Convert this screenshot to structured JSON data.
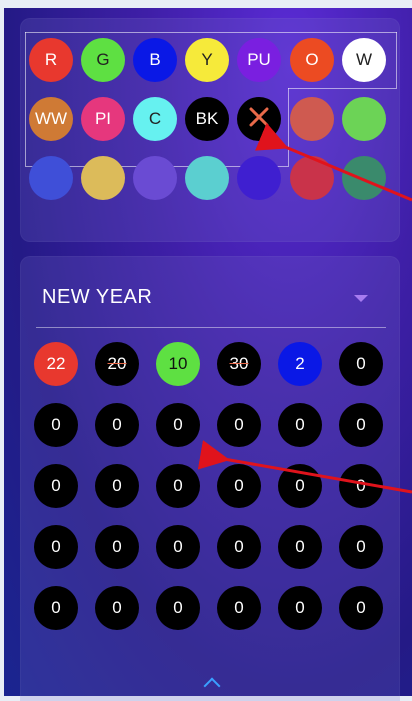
{
  "palette": {
    "row1": [
      {
        "label": "R",
        "color": "#e8382e"
      },
      {
        "label": "G",
        "color": "#5ee042"
      },
      {
        "label": "B",
        "color": "#0a18e6"
      },
      {
        "label": "Y",
        "color": "#f6ea3a"
      },
      {
        "label": "PU",
        "color": "#7a1fe0"
      },
      {
        "label": "O",
        "color": "#ec4b22"
      },
      {
        "label": "W",
        "color": "#ffffff"
      }
    ],
    "row2": [
      {
        "label": "WW",
        "color": "#cf7a35"
      },
      {
        "label": "PI",
        "color": "#e6377d"
      },
      {
        "label": "C",
        "color": "#66f1f0"
      },
      {
        "label": "BK",
        "color": "#000000"
      },
      {
        "label": "",
        "color": "#000000",
        "icon": "close-icon"
      },
      {
        "label": "",
        "color": "#cf5a50"
      },
      {
        "label": "",
        "color": "#6cd356"
      }
    ],
    "row3": [
      {
        "color": "#3f4fd8"
      },
      {
        "color": "#dcbb5a"
      },
      {
        "color": "#6a4bd3"
      },
      {
        "color": "#5bcfd0"
      },
      {
        "color": "#3f1fd0"
      },
      {
        "color": "#c9334a"
      },
      {
        "color": "#3a8a6c"
      }
    ]
  },
  "memories": {
    "title": "NEW YEAR",
    "rows": [
      [
        {
          "value": "22",
          "color": "#e8382e"
        },
        {
          "value": "20",
          "color": "#000000",
          "strike": true
        },
        {
          "value": "10",
          "color": "#5ee042"
        },
        {
          "value": "30",
          "color": "#000000",
          "strike": true
        },
        {
          "value": "2",
          "color": "#0a18e6"
        },
        {
          "value": "0",
          "color": "#000000"
        }
      ],
      [
        {
          "value": "0"
        },
        {
          "value": "0"
        },
        {
          "value": "0"
        },
        {
          "value": "0"
        },
        {
          "value": "0"
        },
        {
          "value": "0"
        }
      ],
      [
        {
          "value": "0"
        },
        {
          "value": "0"
        },
        {
          "value": "0"
        },
        {
          "value": "0"
        },
        {
          "value": "0"
        },
        {
          "value": "0"
        }
      ],
      [
        {
          "value": "0"
        },
        {
          "value": "0"
        },
        {
          "value": "0"
        },
        {
          "value": "0"
        },
        {
          "value": "0"
        },
        {
          "value": "0"
        }
      ],
      [
        {
          "value": "0"
        },
        {
          "value": "0"
        },
        {
          "value": "0"
        },
        {
          "value": "0"
        },
        {
          "value": "0"
        },
        {
          "value": "0"
        }
      ]
    ]
  },
  "colors": {
    "annotation_arrow": "#e0131c",
    "collapse_chevron": "#3aa0ff"
  }
}
